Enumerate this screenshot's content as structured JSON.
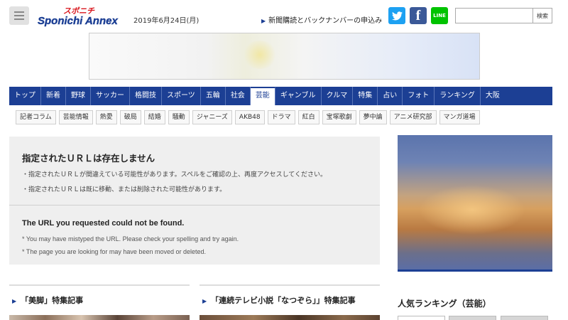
{
  "header": {
    "logo_top": "スポニチ",
    "logo_main": "Sponichi Annex",
    "date": "2019年6月24日(月)",
    "subscribe_link": "新聞購読とバックナンバーの申込み",
    "search": {
      "placeholder": "",
      "button_label": "検索"
    },
    "social": {
      "line_label": "LINE",
      "facebook_glyph": "f"
    }
  },
  "main_nav": [
    {
      "label": "トップ"
    },
    {
      "label": "新着"
    },
    {
      "label": "野球"
    },
    {
      "label": "サッカー"
    },
    {
      "label": "格闘技"
    },
    {
      "label": "スポーツ"
    },
    {
      "label": "五輪"
    },
    {
      "label": "社会"
    },
    {
      "label": "芸能",
      "active": true
    },
    {
      "label": "ギャンブル"
    },
    {
      "label": "クルマ"
    },
    {
      "label": "特集"
    },
    {
      "label": "占い"
    },
    {
      "label": "フォト"
    },
    {
      "label": "ランキング"
    },
    {
      "label": "大阪"
    }
  ],
  "sub_nav": [
    "記者コラム",
    "芸能情報",
    "熱愛",
    "破局",
    "結婚",
    "騒動",
    "ジャニーズ",
    "AKB48",
    "ドラマ",
    "紅白",
    "宝塚歌劇",
    "夢中論",
    "アニメ研究部",
    "マンガ道場"
  ],
  "error": {
    "title_ja": "指定されたＵＲＬは存在しません",
    "lines_ja": [
      "・指定されたＵＲＬが間違えている可能性があります。スペルをご確認の上、再度アクセスしてください。",
      "・指定されたＵＲＬは既に移動、または削除された可能性があります。"
    ],
    "title_en": "The URL you requested could not be found.",
    "lines_en": [
      "* You may have mistyped the URL. Please check your spelling and try again.",
      "* The page you are looking for may have been moved or deleted."
    ]
  },
  "sections": [
    {
      "title": "「美脚」特集記事"
    },
    {
      "title": "「連続テレビ小説「なつぞら」」特集記事"
    }
  ],
  "ranking": {
    "title": "人気ランキング（芸能）"
  },
  "colors": {
    "brand_blue": "#1c3f94",
    "twitter": "#1da1f2",
    "facebook": "#3b5998",
    "line": "#00c300"
  }
}
